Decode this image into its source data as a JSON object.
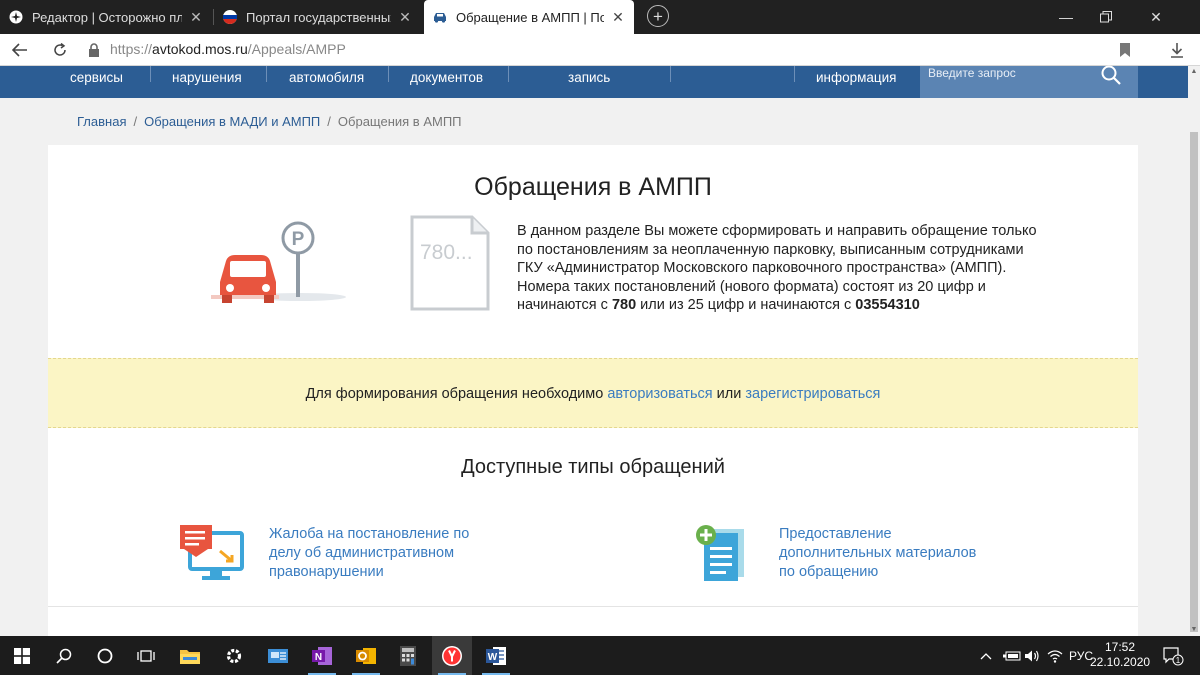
{
  "browser": {
    "tabs": [
      {
        "title": "Редактор | Осторожно плат"
      },
      {
        "title": "Портал государственных усл"
      },
      {
        "title": "Обращение в АМПП | Порта"
      }
    ],
    "url_prefix": "https://",
    "url_domain": "avtokod.mos.ru",
    "url_path": "/Appeals/AMPP"
  },
  "site_nav": {
    "items": [
      "сервисы",
      "нарушения",
      "автомобиля",
      "документов",
      "запись",
      "информация"
    ],
    "search_placeholder": "Введите запрос"
  },
  "breadcrumb": {
    "home": "Главная",
    "section": "Обращения в МАДИ и АМПП",
    "current": "Обращения в АМПП"
  },
  "page": {
    "title": "Обращения в АМПП",
    "doc_number": "780...",
    "intro": {
      "text_1": "В данном разделе Вы можете сформировать и направить обращение только по постановлениям за неоплаченную парковку, выписанным сотрудниками ГКУ «Администратор Московского парковочного пространства» (АМПП). Номера таких постановлений (нового формата) состоят из 20 цифр и начинаются с ",
      "bold_1": "780",
      "text_2": " или из 25 цифр и начинаются с ",
      "bold_2": "03554310"
    },
    "notice": {
      "text": "Для формирования обращения необходимо ",
      "login_link": "авторизоваться",
      "or": " или ",
      "register_link": "зарегистрироваться"
    },
    "types_title": "Доступные типы обращений",
    "types": [
      {
        "label_lines": [
          "Жалоба на постановление по",
          "делу об административном",
          "правонарушении"
        ]
      },
      {
        "label_lines": [
          "Предоставление",
          "дополнительных материалов",
          "по обращению"
        ]
      }
    ]
  },
  "taskbar": {
    "lang": "РУС",
    "time": "17:52",
    "date": "22.10.2020",
    "notifications": "1"
  },
  "colors": {
    "site_header": "#2c5d94",
    "link": "#3a7cc0",
    "notice_bg": "#fbf5c5",
    "car": "#e8553f"
  }
}
